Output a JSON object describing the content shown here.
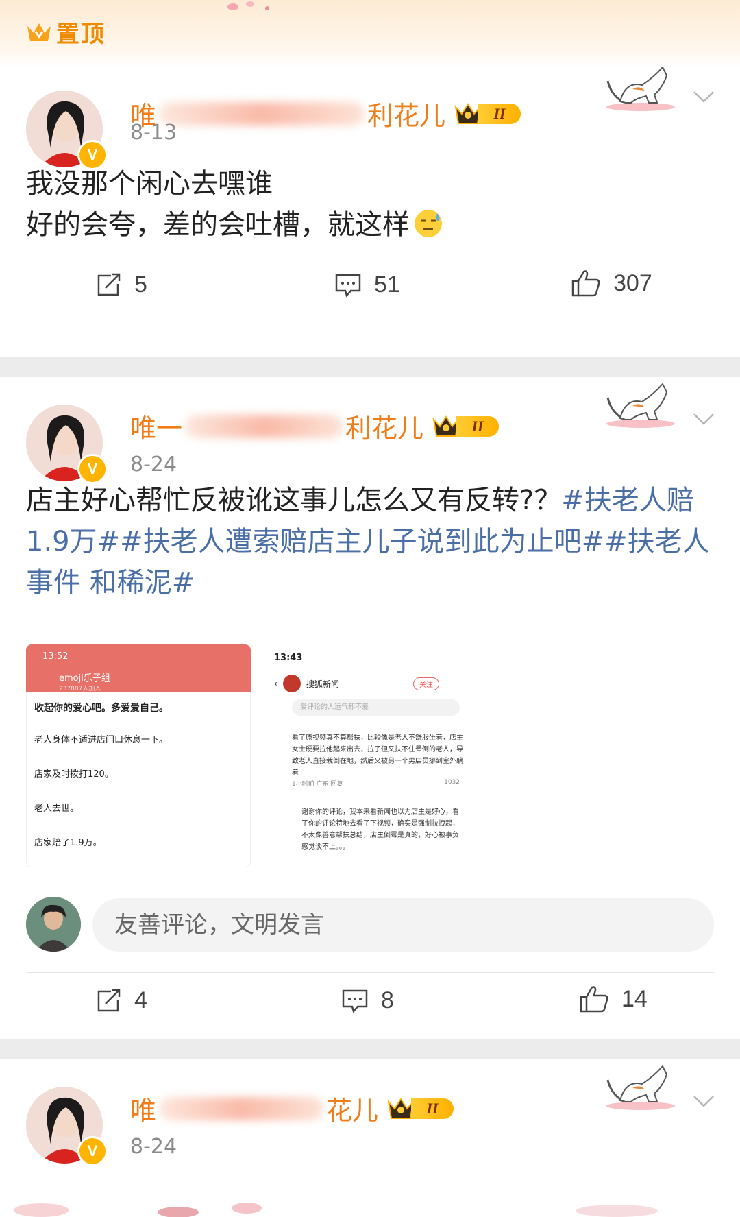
{
  "pinned": {
    "label": "置顶"
  },
  "posts": [
    {
      "user": {
        "name_prefix": "唯",
        "name_suffix": "利花儿",
        "level": "II"
      },
      "date": "8-13",
      "content_lines": [
        "我没那个闲心去嘿谁",
        "好的会夸，差的会吐槽，就这样"
      ],
      "emoji": "sweat-face-emoji",
      "actions": {
        "repost": "5",
        "comment": "51",
        "like": "307"
      }
    },
    {
      "user": {
        "name_prefix": "唯一",
        "name_suffix": "利花儿",
        "level": "II"
      },
      "date": "8-24",
      "content_text": "店主好心帮忙反被讹这事儿怎么又有反转?？",
      "content_tags": "#扶老人赔1.9万##扶老人遭索赔店主儿子说到此为止吧##扶老人事件 和稀泥#",
      "shot1": {
        "time": "13:52",
        "app": "emoji乐子组",
        "members": "237887人加入",
        "lines": [
          "收起你的爱心吧。多爱爱自己。",
          "老人身体不适进店门口休息一下。",
          "店家及时拨打120。",
          "老人去世。",
          "店家赔了1.9万。"
        ]
      },
      "shot2": {
        "time": "13:43",
        "source": "搜狐新闻",
        "follow": "关注",
        "search_placeholder": "爱评论的人运气都不差",
        "comment1": "看了原视频真不算帮扶，比较像是老人不舒服坐着，店主女士硬要拉他起来出去，拉了但又扶不住晕倒的老人，导致老人直接栽倒在地，然后又被另一个男店员挪到室外躺着",
        "meta1_left": "1小时前 广东  回复",
        "meta1_right": "1032",
        "comment2": "谢谢你的评论，我本来看新闻也以为店主是好心，看了你的评论特地去看了下视频，确实是强制拉拽起，不太像善意帮扶总结，店主倒霉是真的，好心被事负感觉谈不上。。。"
      },
      "comment_box": {
        "placeholder": "友善评论，文明发言"
      },
      "actions": {
        "repost": "4",
        "comment": "8",
        "like": "14"
      }
    },
    {
      "user": {
        "name_prefix": "唯",
        "name_suffix": "花儿",
        "level": "II"
      },
      "date": "8-24"
    }
  ],
  "colors": {
    "username": "#f07d1a",
    "hashtag": "#4a6ea6",
    "date": "#8a8a8a"
  }
}
